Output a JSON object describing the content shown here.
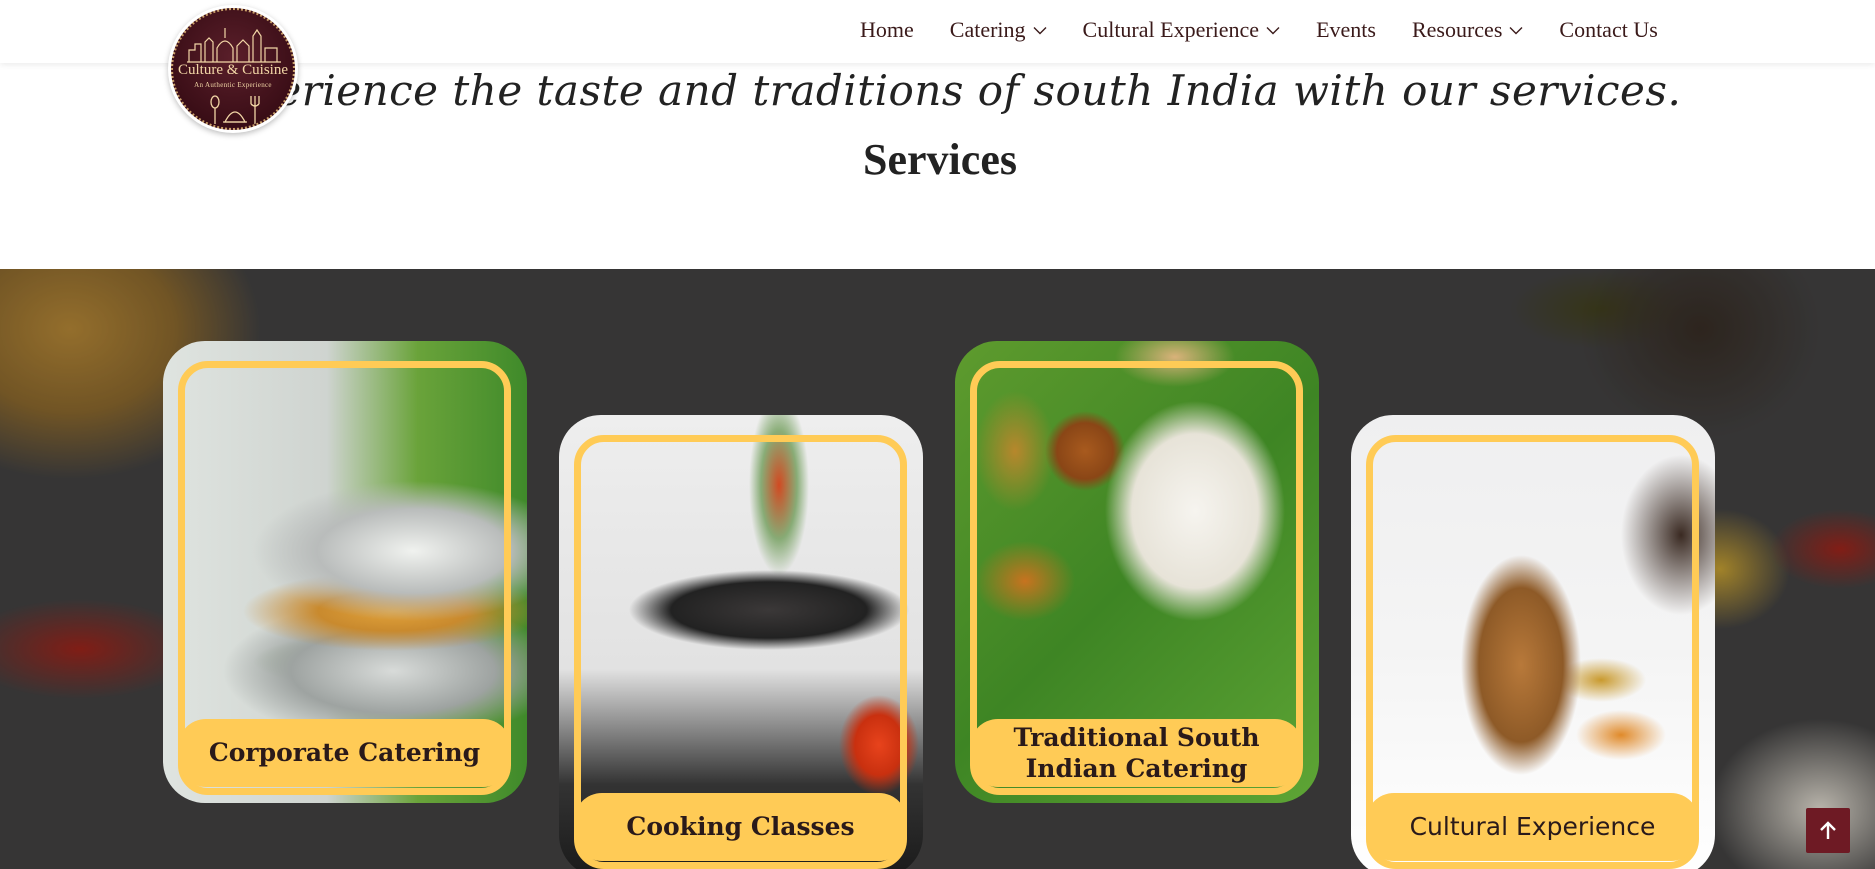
{
  "brand": {
    "logo_title": "Culture & Cuisine",
    "logo_subtitle": "An Authentic Experience"
  },
  "nav": {
    "items": [
      {
        "label": "Home",
        "has_dropdown": false
      },
      {
        "label": "Catering",
        "has_dropdown": true
      },
      {
        "label": "Cultural Experience",
        "has_dropdown": true
      },
      {
        "label": "Events",
        "has_dropdown": false
      },
      {
        "label": "Resources",
        "has_dropdown": true
      },
      {
        "label": "Contact Us",
        "has_dropdown": false
      }
    ]
  },
  "intro": {
    "tagline": "Experience the taste and traditions of south India with our services.",
    "section_title": "Services"
  },
  "services": [
    {
      "label": "Corporate Catering"
    },
    {
      "label": "Cooking Classes"
    },
    {
      "label": "Traditional South Indian Catering"
    },
    {
      "label": "Cultural Experience"
    }
  ],
  "icons": {
    "dropdown": "chevron-down-icon",
    "back_to_top": "arrow-up-icon"
  },
  "colors": {
    "accent_yellow": "#ffcb56",
    "brand_maroon": "#6e1a24",
    "nav_text": "#3a1a1a"
  }
}
